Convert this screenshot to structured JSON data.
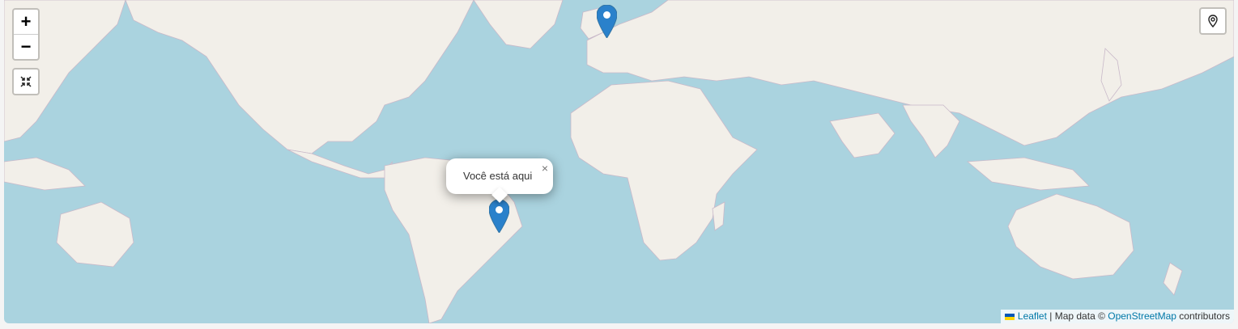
{
  "map": {
    "controls": {
      "zoom_in": "+",
      "zoom_out": "−"
    },
    "markers": [
      {
        "name": "europe-marker"
      },
      {
        "name": "brazil-marker"
      }
    ],
    "popup": {
      "text": "Você está aqui",
      "close": "×"
    },
    "attribution": {
      "leaflet": "Leaflet",
      "separator": " | Map data © ",
      "osm": "OpenStreetMap",
      "suffix": " contributors"
    },
    "colors": {
      "water": "#aad3df",
      "land": "#f2efe9",
      "marker": "#2a81cb",
      "link": "#0078a8"
    }
  }
}
